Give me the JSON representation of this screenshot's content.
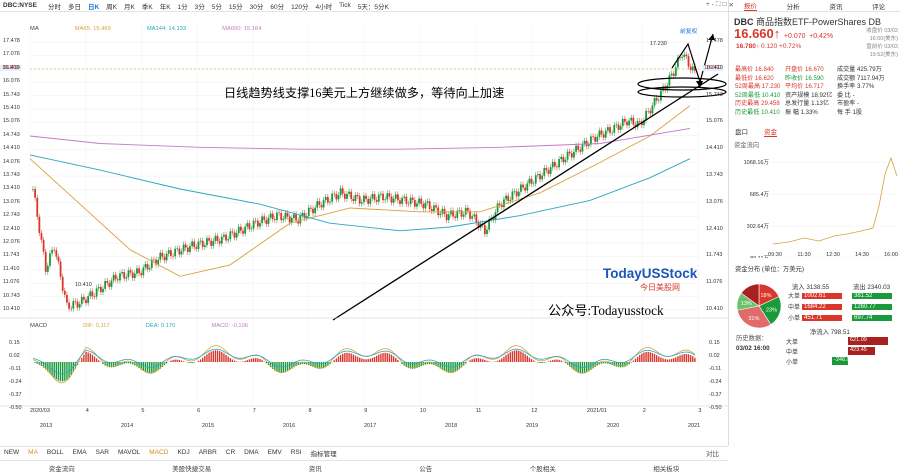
{
  "topbar": {
    "symbol": "DBC:NYSE",
    "items": [
      "分时",
      "多日",
      "日K",
      "周K",
      "月K",
      "季K",
      "年K",
      "1分",
      "3分",
      "5分",
      "15分",
      "30分",
      "60分",
      "120分",
      "4小时",
      "Tick",
      "5天：5分K"
    ],
    "active": "日K",
    "right_buttons": [
      "+",
      "-",
      "⛶",
      "□",
      "✕"
    ]
  },
  "annotation_text": "日线趋势线支撑16美元上方继续做多，等待向上加速",
  "brand": {
    "name": "TodayUSStock",
    "sub": "今日美股网",
    "wechat": "公众号:Todayusstock"
  },
  "ma_legend": [
    {
      "label": "MA",
      "color": "#444"
    },
    {
      "label": "MA65: 15.469",
      "color": "#d9a23a"
    },
    {
      "label": "MA144: 14.133",
      "color": "#2aa6c4"
    },
    {
      "label": "MA600: 15.164",
      "color": "#c47ac4"
    }
  ],
  "macd_legend": [
    {
      "label": "MACD",
      "color": "#444"
    },
    {
      "label": "DIF: 0.117",
      "color": "#d9a23a"
    },
    {
      "label": "DEA: 0.170",
      "color": "#2aa6c4"
    },
    {
      "label": "MACD: -0.106",
      "color": "#c47ac4"
    }
  ],
  "price_marker_left": "16.660",
  "price_marker_right": "16.660",
  "high_marker": "17.230",
  "low_marker": "10.410",
  "flag_label": "前复权",
  "y_axis": [
    "17.478",
    "17.076",
    "16.410",
    "16.076",
    "15.743",
    "15.410",
    "15.076",
    "14.743",
    "14.410",
    "14.076",
    "13.743",
    "13.410",
    "13.076",
    "12.743",
    "12.410",
    "12.076",
    "11.743",
    "11.410",
    "11.076",
    "10.743",
    "10.410"
  ],
  "y_axis_right": [
    "17.478",
    "16.410",
    "15.743",
    "15.076",
    "14.410",
    "13.743",
    "13.076",
    "12.410",
    "11.743",
    "11.076",
    "10.410"
  ],
  "macd_axis": [
    "0.15",
    "0.02",
    "-0.11",
    "-0.24",
    "-0.37",
    "-0.50"
  ],
  "x_months": [
    "2020/03",
    "4",
    "5",
    "6",
    "7",
    "8",
    "9",
    "10",
    "11",
    "12",
    "2021/01",
    "2",
    "3"
  ],
  "x_years": [
    "2013",
    "2014",
    "2015",
    "2016",
    "2017",
    "2018",
    "2019",
    "2020",
    "2021"
  ],
  "indicators": [
    "NEW",
    "MA",
    "BOLL",
    "EMA",
    "SAR",
    "MAVOL",
    "MACD",
    "KDJ",
    "ARBR",
    "CR",
    "DMA",
    "EMV",
    "RSI",
    "指标管理"
  ],
  "indicators_active": [
    "MA",
    "MACD"
  ],
  "indicator_right": "对比",
  "newsbar": [
    "资金流向",
    "美股快捷交易",
    "资讯",
    "公告",
    "个股相关",
    "相关板块"
  ],
  "right_tabs": [
    "报价",
    "分析",
    "资讯",
    "评论"
  ],
  "stock": {
    "code": "DBC",
    "name": "商品指数ETF-PowerShares DB",
    "price": "16.660",
    "arrow": "↑",
    "chg": "+0.070",
    "pct": "+0.42%",
    "status1": "收盘价 03/02 16:00(美东)",
    "status2": "盘前价 03/03 19:52(美东)",
    "pre_price": "16.780",
    "pre_arrow": "↑",
    "pre_chg": "0.120",
    "pre_pct": "+0.72%"
  },
  "quote_rows": [
    [
      "最高价 16.840",
      "开盘价 16.670",
      "成交量 425.79万"
    ],
    [
      "最低价 16.620",
      "昨收价 16.590",
      "成交额 7117.94万"
    ],
    [
      "52周最高 17.230",
      "平均价 16.717",
      "换手率 3.77%"
    ],
    [
      "52周最低 10.410",
      "资产规模 18.92亿",
      "委 比 -"
    ],
    [
      "历史最高 29.458",
      "总发行量 1.13亿",
      "市盈率 -"
    ],
    [
      "历史最低 10.410",
      "振 幅 1.33%",
      "每 手 1股"
    ]
  ],
  "sub_tabs": [
    "盘口",
    "资金"
  ],
  "flow_title": "资金流向",
  "flow_axis": [
    "1068.16万",
    "685.4万",
    "302.64万",
    "-80.11万"
  ],
  "flow_times": [
    "09:30",
    "11:30",
    "12:30",
    "14:30",
    "16:00"
  ],
  "dist_label": "资金分布 (单位：万美元)",
  "inflow_label": "流入 3138.55",
  "outflow_label": "流出 2340.03",
  "pie": [
    {
      "label": "18%",
      "value": 18,
      "color": "#d9372b"
    },
    {
      "label": "23%",
      "value": 23,
      "color": "#1a9a3a"
    },
    {
      "label": "31%",
      "value": 31,
      "color": "#e06b6b"
    },
    {
      "label": "13%",
      "value": 13,
      "color": "#6cc06c"
    },
    {
      "label": "",
      "value": 15,
      "color": "#a82020"
    }
  ],
  "dist_rows": [
    [
      "大单",
      "1002.61",
      "381.52"
    ],
    [
      "中单",
      "1684.22",
      "1260.77"
    ],
    [
      "小单",
      "451.71",
      "697.74"
    ]
  ],
  "net_label": "净流入 798.51",
  "hist_label": "历史数据：",
  "hist_date": "03/02 16:00",
  "net_rows": [
    [
      "大单",
      "621.09",
      621.09
    ],
    [
      "中单",
      "423.45",
      423.45
    ],
    [
      "小单",
      "-246.03",
      -246.03
    ]
  ]
}
